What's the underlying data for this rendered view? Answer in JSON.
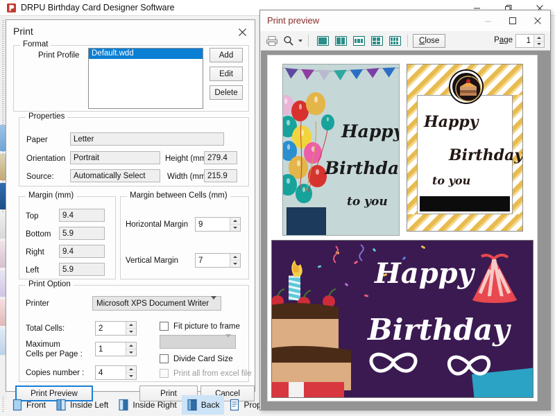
{
  "app": {
    "title": "DRPU Birthday Card Designer Software",
    "icon": "app-icon",
    "window_buttons": [
      "minimize",
      "restore",
      "close"
    ]
  },
  "print_dialog": {
    "title": "Print",
    "close_icon": "close-icon",
    "format": {
      "legend": "Format",
      "print_profile_label": "Print Profile",
      "selected_profile": "Default.wdd",
      "buttons": {
        "add": "Add",
        "edit": "Edit",
        "delete": "Delete"
      }
    },
    "properties": {
      "legend": "Properties",
      "paper_label": "Paper",
      "paper_value": "Letter",
      "orientation_label": "Orientation",
      "orientation_value": "Portrait",
      "height_label": "Height (mm)",
      "height_value": "279.4",
      "source_label": "Source:",
      "source_value": "Automatically Select",
      "width_label": "Width (mm)",
      "width_value": "215.9"
    },
    "margin": {
      "legend": "Margin (mm)",
      "top_label": "Top",
      "top_value": "9.4",
      "bottom_label": "Bottom",
      "bottom_value": "5.9",
      "right_label": "Right",
      "right_value": "9.4",
      "left_label": "Left",
      "left_value": "5.9"
    },
    "margin_between_cells": {
      "legend": "Margin between Cells (mm)",
      "horizontal_label": "Horizontal Margin",
      "horizontal_value": "9",
      "vertical_label": "Vertical Margin",
      "vertical_value": "7"
    },
    "print_option": {
      "legend": "Print Option",
      "printer_label": "Printer",
      "printer_value": "Microsoft XPS Document Writer",
      "total_cells_label": "Total Cells:",
      "total_cells_value": "2",
      "max_cells_label_line1": "Maximum",
      "max_cells_label_line2": "Cells per Page :",
      "max_cells_value": "1",
      "copies_label": "Copies number :",
      "copies_value": "4",
      "fit_picture_label": "Fit picture to frame",
      "fit_picture_checked": false,
      "frame_combo_value": "",
      "frame_combo_disabled": true,
      "divide_card_label": "Divide Card Size",
      "divide_card_checked": false,
      "print_all_excel_label": "Print all from excel file",
      "print_all_excel_checked": false,
      "print_all_excel_disabled": true
    },
    "actions": {
      "print_preview": "Print Preview",
      "print": "Print",
      "cancel": "Cancel"
    }
  },
  "card_tabs": {
    "items": [
      {
        "label": "Front",
        "icon": "book-front-icon",
        "active": false
      },
      {
        "label": "Inside Left",
        "icon": "book-inside-left-icon",
        "active": false
      },
      {
        "label": "Inside Right",
        "icon": "book-inside-right-icon",
        "active": false
      },
      {
        "label": "Back",
        "icon": "book-back-icon",
        "active": true
      },
      {
        "label": "Prop",
        "icon": "properties-icon",
        "active": false
      }
    ]
  },
  "print_preview": {
    "title": "Print preview",
    "window_buttons": [
      "minimize",
      "maximize",
      "close"
    ],
    "toolbar": {
      "print_icon": "printer-icon",
      "zoom_icon": "magnifier-icon",
      "zoom_dropdown_icon": "chevron-down-icon",
      "layout_buttons": [
        {
          "name": "one-page-layout",
          "cells": 1
        },
        {
          "name": "two-page-layout",
          "cells": 2
        },
        {
          "name": "three-page-layout",
          "cells": 3
        },
        {
          "name": "four-page-layout",
          "cells": 4
        },
        {
          "name": "six-page-layout",
          "cells": 6
        }
      ],
      "close_label": "Close",
      "page_label_pre": "P",
      "page_label_accel": "a",
      "page_label_post": "ge",
      "page_value": "1"
    },
    "cards": [
      {
        "name": "balloons-bunting-card",
        "background": "#c6d7d7",
        "lines": [
          "Happy",
          "Birthday",
          "to you"
        ],
        "text_color": "#1a1a1a"
      },
      {
        "name": "gold-chevron-cake-card",
        "background": "#ffffff",
        "accent": "#e8bb4e",
        "lines": [
          "Happy",
          "Birthday",
          "to you"
        ],
        "text_color": "#231714"
      },
      {
        "name": "purple-cake-card",
        "background": "#3b1a52",
        "lines": [
          "Happy",
          "Birthday"
        ],
        "text_color": "#ffffff"
      }
    ]
  }
}
